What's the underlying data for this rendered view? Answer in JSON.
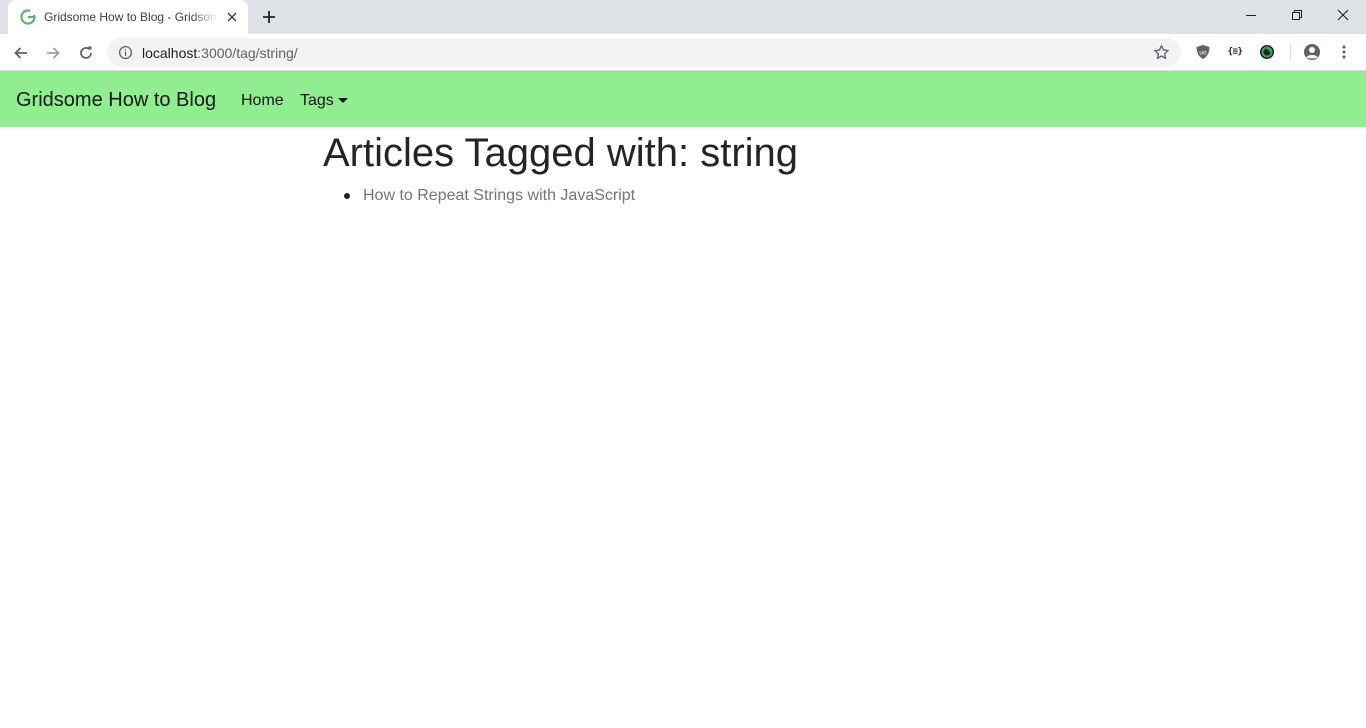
{
  "browser": {
    "tab": {
      "title": "Gridsome How to Blog - Gridsome"
    },
    "address_bar": {
      "host": "localhost",
      "path": ":3000/tag/string/"
    },
    "icons": {
      "favicon": "gridsome-favicon-icon",
      "tab_close": "close-icon",
      "new_tab": "plus-icon",
      "back": "arrow-left-icon",
      "forward": "arrow-right-icon",
      "reload": "reload-icon",
      "site_info": "info-icon",
      "bookmark": "star-icon",
      "ublock": "shield-icon",
      "json_viewer": "json-icon",
      "extension": "extension-icon",
      "profile": "profile-icon",
      "menu": "kebab-menu-icon"
    },
    "json_ext_glyph": "{≡}"
  },
  "navbar": {
    "brand": "Gridsome How to Blog",
    "links": [
      {
        "label": "Home"
      },
      {
        "label": "Tags"
      }
    ],
    "background": "#90ee90"
  },
  "main": {
    "title": "Articles Tagged with: string",
    "articles": [
      {
        "title": "How to Repeat Strings with JavaScript"
      }
    ]
  }
}
